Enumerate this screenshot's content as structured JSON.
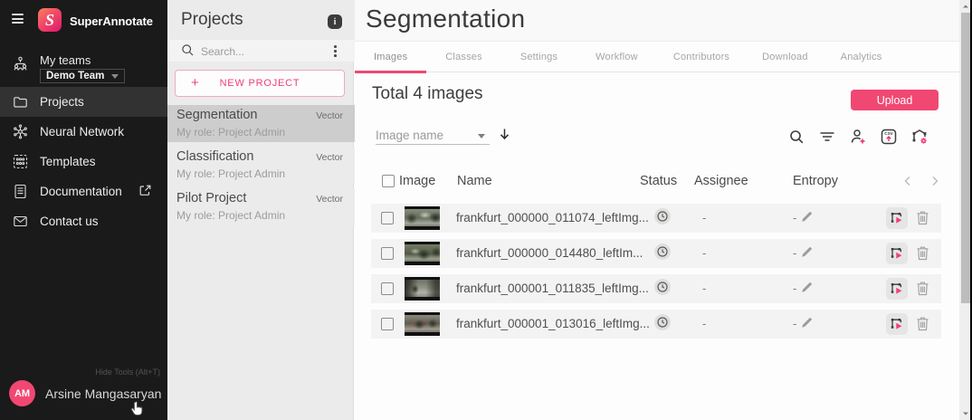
{
  "colors": {
    "accent": "#e8336d"
  },
  "sidebar": {
    "brand": "SuperAnnotate",
    "teams_label": "My teams",
    "team_selector": "Demo Team",
    "items": [
      {
        "label": "Projects",
        "icon": "folder-icon",
        "active": true
      },
      {
        "label": "Neural Network",
        "icon": "neural-network-icon"
      },
      {
        "label": "Templates",
        "icon": "templates-icon"
      },
      {
        "label": "Documentation",
        "icon": "documentation-icon",
        "external": true
      },
      {
        "label": "Contact us",
        "icon": "contact-icon"
      }
    ],
    "hide_tools_label": "Hide Tools (Alt+T)",
    "user": {
      "initials": "AM",
      "name": "Arsine Mangasaryan"
    }
  },
  "projects_panel": {
    "title": "Projects",
    "search_placeholder": "Search...",
    "new_project_label": "NEW PROJECT",
    "projects": [
      {
        "name": "Segmentation",
        "type": "Vector",
        "role": "My role: Project Admin",
        "selected": true
      },
      {
        "name": "Classification",
        "type": "Vector",
        "role": "My role: Project Admin",
        "selected": false
      },
      {
        "name": "Pilot Project",
        "type": "Vector",
        "role": "My role: Project Admin",
        "selected": false
      }
    ]
  },
  "main": {
    "title": "Segmentation",
    "tabs": [
      {
        "label": "Images",
        "active": true
      },
      {
        "label": "Classes",
        "active": false
      },
      {
        "label": "Settings",
        "active": false
      },
      {
        "label": "Workflow",
        "active": false
      },
      {
        "label": "Contributors",
        "active": false
      },
      {
        "label": "Download",
        "active": false
      },
      {
        "label": "Analytics",
        "active": false
      }
    ],
    "total_label": "Total 4 images",
    "upload_label": "Upload",
    "sort_value": "Image name",
    "table": {
      "columns": [
        "Image",
        "Name",
        "Status",
        "Assignee",
        "Entropy"
      ],
      "rows": [
        {
          "name": "frankfurt_000000_011074_leftImg...",
          "status": "pending",
          "assignee": "-",
          "entropy": "-"
        },
        {
          "name": "frankfurt_000000_014480_leftIm...",
          "status": "pending",
          "assignee": "-",
          "entropy": "-"
        },
        {
          "name": "frankfurt_000001_011835_leftImg...",
          "status": "pending",
          "assignee": "-",
          "entropy": "-"
        },
        {
          "name": "frankfurt_000001_013016_leftImg...",
          "status": "pending",
          "assignee": "-",
          "entropy": "-"
        }
      ]
    }
  }
}
